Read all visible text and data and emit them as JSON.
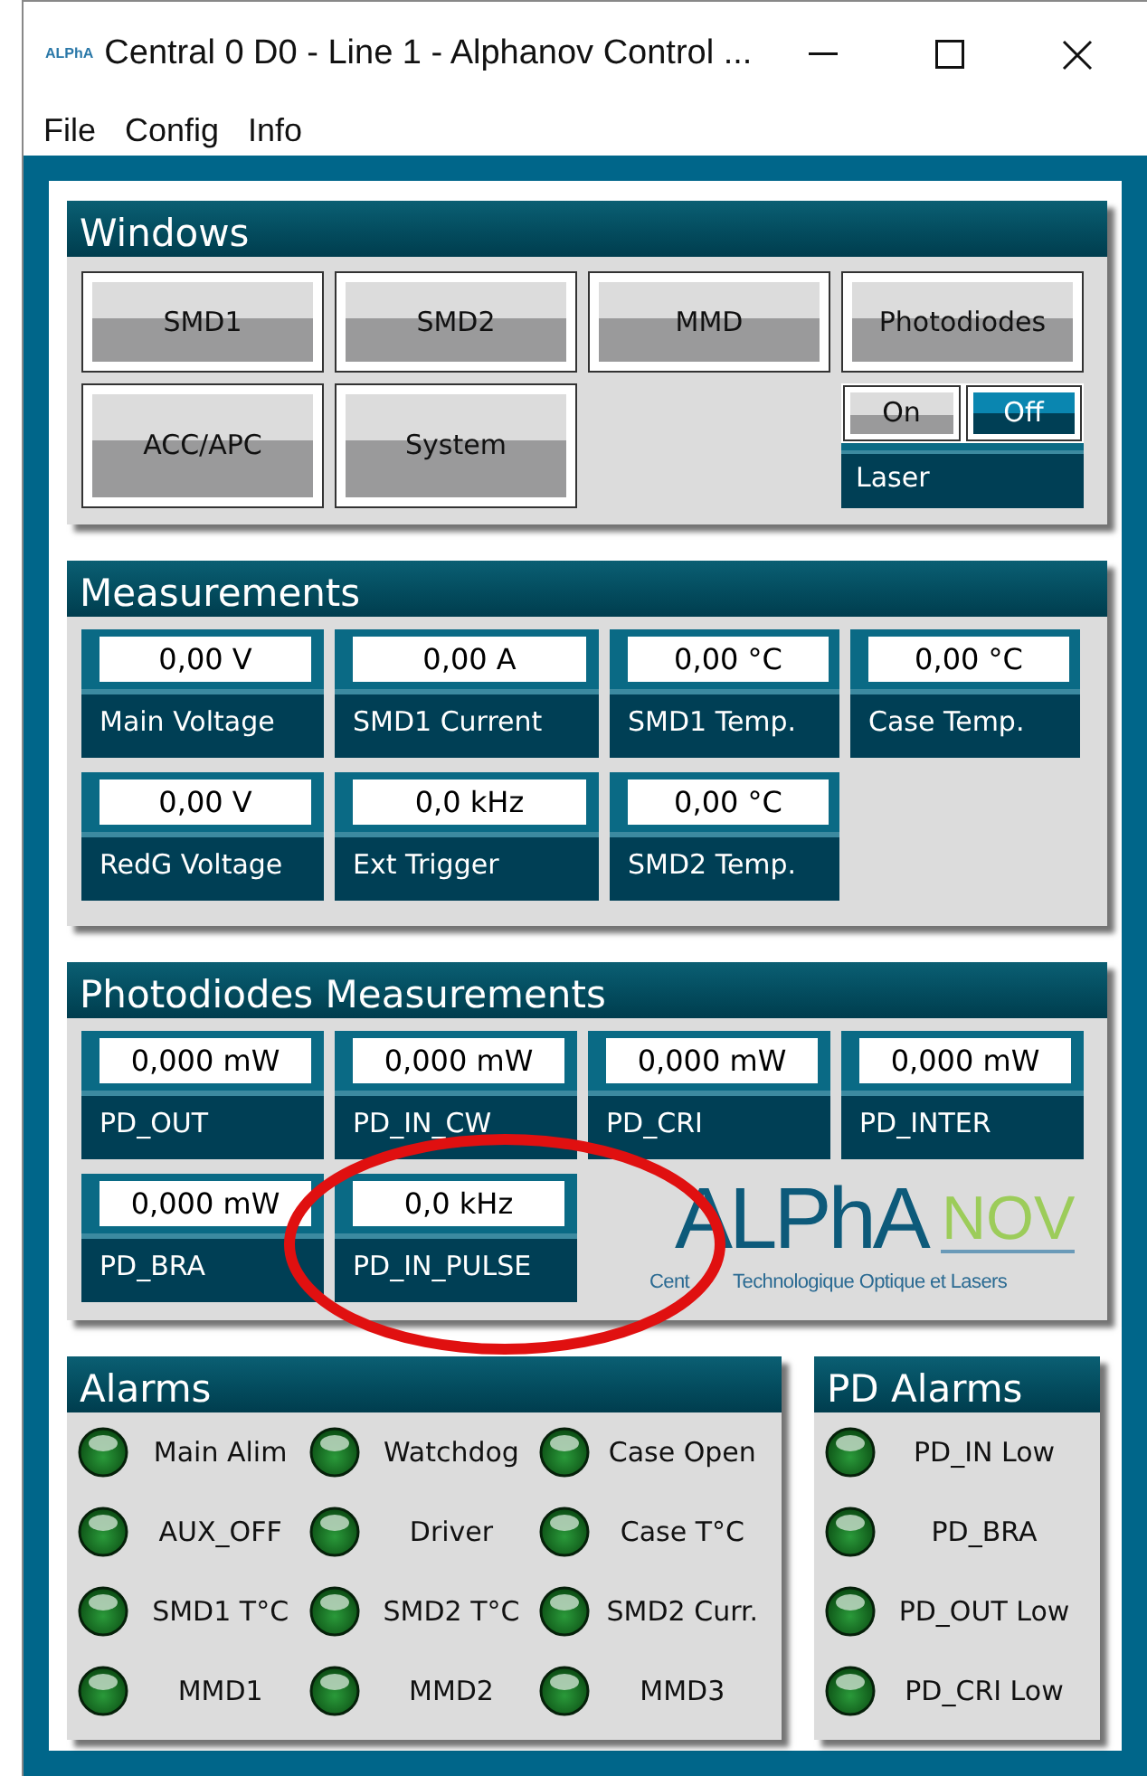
{
  "window": {
    "title": "Central 0 D0 - Line 1 - Alphanov Control ...",
    "app_icon_text": "ALPhA"
  },
  "menu": [
    "File",
    "Config",
    "Info"
  ],
  "windows_panel": {
    "title": "Windows",
    "buttons": [
      "SMD1",
      "SMD2",
      "MMD",
      "Photodiodes",
      "ACC/APC",
      "System"
    ],
    "laser": {
      "label": "Laser",
      "options": [
        {
          "label": "On",
          "selected": false
        },
        {
          "label": "Off",
          "selected": true
        }
      ]
    }
  },
  "measurements": {
    "title": "Measurements",
    "tiles": [
      {
        "value": "0,00 V",
        "label": "Main Voltage"
      },
      {
        "value": "0,00 A",
        "label": "SMD1 Current"
      },
      {
        "value": "0,00 °C",
        "label": "SMD1 Temp."
      },
      {
        "value": "0,00 °C",
        "label": "Case Temp."
      },
      {
        "value": "0,00 V",
        "label": "RedG Voltage"
      },
      {
        "value": "0,0 kHz",
        "label": "Ext Trigger"
      },
      {
        "value": "0,00 °C",
        "label": "SMD2 Temp."
      }
    ]
  },
  "photodiodes": {
    "title": "Photodiodes Measurements",
    "tiles": [
      {
        "value": "0,000 mW",
        "label": "PD_OUT"
      },
      {
        "value": "0,000 mW",
        "label": "PD_IN_CW"
      },
      {
        "value": "0,000 mW",
        "label": "PD_CRI"
      },
      {
        "value": "0,000 mW",
        "label": "PD_INTER"
      },
      {
        "value": "0,000 mW",
        "label": "PD_BRA"
      },
      {
        "value": "0,0 kHz",
        "label": "PD_IN_PULSE"
      }
    ],
    "logo": {
      "brand": "ALPhA",
      "suffix": "NOV",
      "tagline_start": "Cent",
      "tagline_end": "Technologique Optique et Lasers"
    }
  },
  "alarms": {
    "title": "Alarms",
    "items": [
      "Main Alim",
      "Watchdog",
      "Case Open",
      "AUX_OFF",
      "Driver",
      "Case T°C",
      "SMD1 T°C",
      "SMD2 T°C",
      "SMD2 Curr.",
      "MMD1",
      "MMD2",
      "MMD3"
    ]
  },
  "pd_alarms": {
    "title": "PD Alarms",
    "items": [
      "PD_IN Low",
      "PD_BRA",
      "PD_OUT Low",
      "PD_CRI Low"
    ]
  }
}
